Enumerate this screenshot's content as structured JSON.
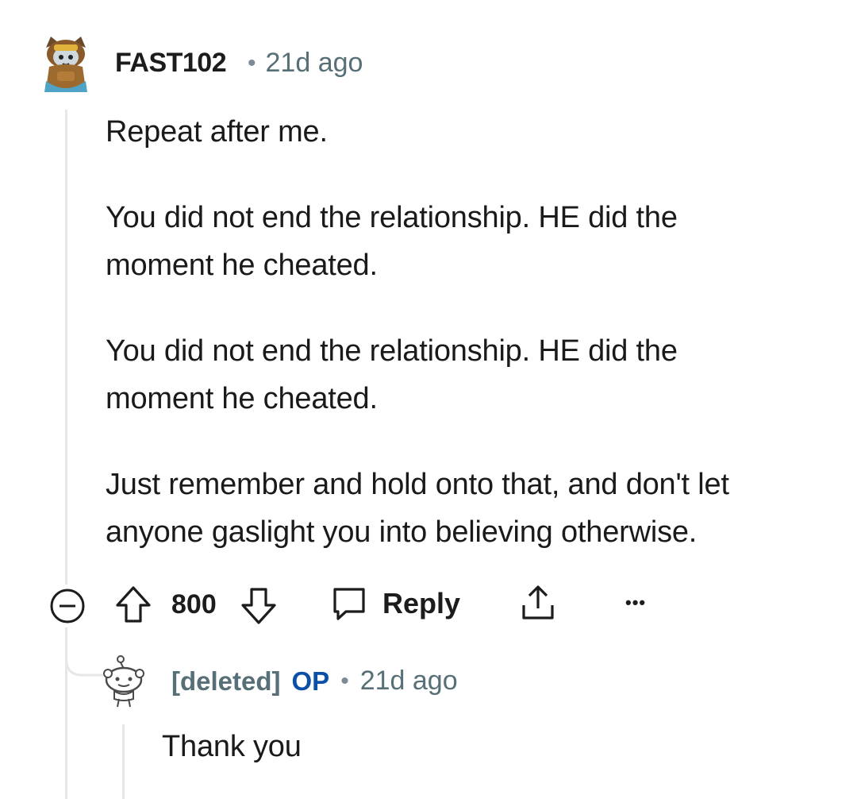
{
  "comment": {
    "author": "FAST102",
    "separator": "•",
    "time": "21d ago",
    "paragraphs": [
      "Repeat after me.",
      "You did not end the relationship. HE did the moment he cheated.",
      "You did not end the relationship. HE did the moment he cheated.",
      "Just remember and hold onto that, and don't let anyone gaslight you into believing otherwise."
    ],
    "actions": {
      "collapse_icon": "collapse-minus-icon",
      "upvote_icon": "arrow-up-icon",
      "vote_count": "800",
      "downvote_icon": "arrow-down-icon",
      "reply_icon": "speech-bubble-icon",
      "reply_label": "Reply",
      "share_icon": "share-icon",
      "more_icon": "ellipsis-icon",
      "more_label": "•••"
    }
  },
  "reply": {
    "author": "[deleted]",
    "op_badge": "OP",
    "separator": "•",
    "time": "21d ago",
    "text": "Thank you"
  },
  "colors": {
    "text": "#1a1a1b",
    "meta": "#576f76",
    "op": "#0b4fa6",
    "thread_line": "#e5e7e9"
  }
}
